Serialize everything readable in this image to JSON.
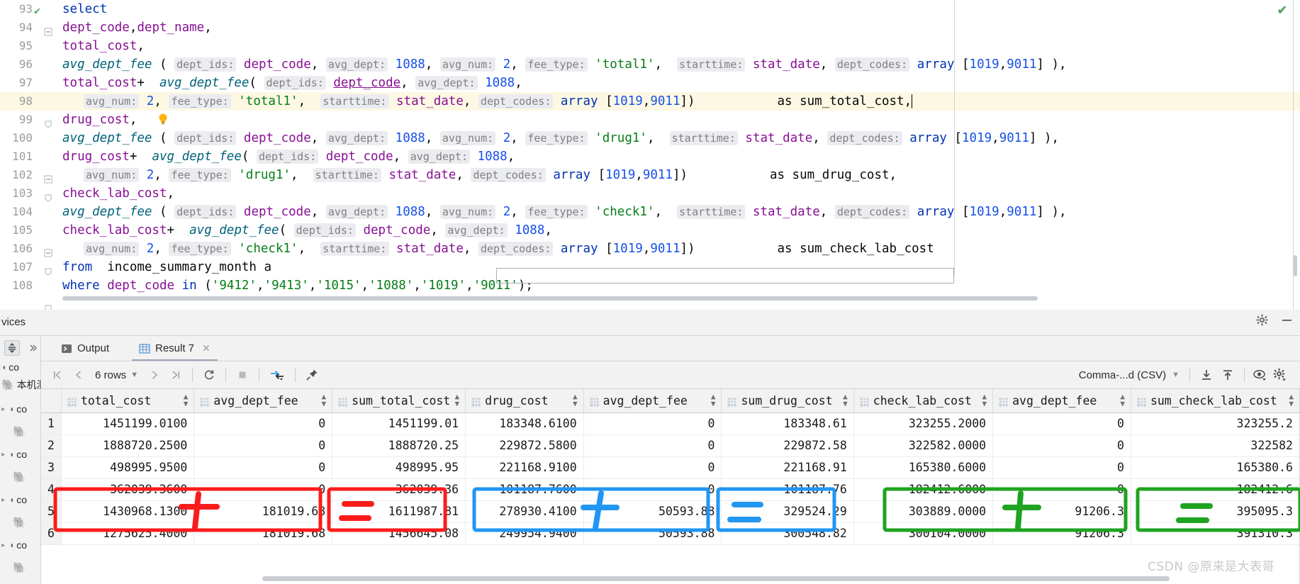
{
  "editor": {
    "first_line_status_icon": "checkmark-icon",
    "lines": [
      {
        "n": "93",
        "code": "select"
      },
      {
        "n": "94",
        "code": "dept_code,dept_name,"
      },
      {
        "n": "95",
        "code": "total_cost,"
      },
      {
        "n": "96",
        "code": "avg_dept_fee ( dept_ids: dept_code, avg_dept: 1088, avg_num: 2, fee_type: 'total1', starttime: stat_date, dept_codes: array [1019,9011] ),"
      },
      {
        "n": "97",
        "code": "total_cost+  avg_dept_fee( dept_ids: dept_code, avg_dept: 1088,"
      },
      {
        "n": "98",
        "code": "   avg_num: 2, fee_type: 'total1', starttime: stat_date, dept_codes: array [1019,9011])           as sum_total_cost,"
      },
      {
        "n": "99",
        "code": "drug_cost,"
      },
      {
        "n": "100",
        "code": "avg_dept_fee ( dept_ids: dept_code, avg_dept: 1088, avg_num: 2, fee_type: 'drug1', starttime: stat_date, dept_codes: array [1019,9011] ),"
      },
      {
        "n": "101",
        "code": "drug_cost+  avg_dept_fee( dept_ids: dept_code, avg_dept: 1088,"
      },
      {
        "n": "102",
        "code": "   avg_num: 2, fee_type: 'drug1', starttime: stat_date, dept_codes: array [1019,9011])           as sum_drug_cost,"
      },
      {
        "n": "103",
        "code": "check_lab_cost,"
      },
      {
        "n": "104",
        "code": "avg_dept_fee ( dept_ids: dept_code, avg_dept: 1088, avg_num: 2, fee_type: 'check1', starttime: stat_date, dept_codes: array [1019,9011] ),"
      },
      {
        "n": "105",
        "code": "check_lab_cost+  avg_dept_fee( dept_ids: dept_code, avg_dept: 1088,"
      },
      {
        "n": "106",
        "code": "   avg_num: 2, fee_type: 'check1', starttime: stat_date, dept_codes: array [1019,9011])           as sum_check_lab_cost"
      },
      {
        "n": "107",
        "code": "from  income_summary_month a"
      },
      {
        "n": "108",
        "code": "where dept_code in ('9412','9413','1015','1088','1019','9011');"
      }
    ]
  },
  "panel": {
    "title": "vices",
    "gear_icon": "gear-icon",
    "minimize_icon": "minimize-icon"
  },
  "sidebar": {
    "expand_all_icon": "expand-all-icon",
    "more_icon": "chevron-double-right-icon",
    "items": [
      {
        "label": "co",
        "icon": "plug-icon"
      },
      {
        "label": "本机测",
        "icon": "elephant-icon"
      },
      {
        "label": "co",
        "icon": "plug-icon"
      },
      {
        "label": "co",
        "icon": "plug-icon"
      },
      {
        "label": "co",
        "icon": "plug-icon"
      },
      {
        "label": "co",
        "icon": "plug-icon"
      },
      {
        "label": "co",
        "icon": "plug-icon"
      }
    ]
  },
  "tabs": [
    {
      "label": "Output",
      "icon": "console-icon",
      "selected": false,
      "closable": false
    },
    {
      "label": "Result 7",
      "icon": "table-icon",
      "selected": true,
      "closable": true
    }
  ],
  "result_toolbar": {
    "first_page_icon": "first-page-icon",
    "prev_page_icon": "prev-page-icon",
    "rows_label": "6 rows",
    "rows_dropdown_icon": "chevron-down-icon",
    "next_page_icon": "next-page-icon",
    "last_page_icon": "last-page-icon",
    "reload_icon": "refresh-icon",
    "stop_icon": "stop-icon",
    "transpose_icon": "transpose-icon",
    "pin_icon": "pin-icon",
    "format_label": "Comma-...d (CSV)",
    "format_dropdown_icon": "chevron-down-icon",
    "download_icon": "download-icon",
    "upload_icon": "upload-icon",
    "view_icon": "eye-icon",
    "settings_icon": "gear-icon"
  },
  "grid": {
    "columns": [
      {
        "name": "total_cost"
      },
      {
        "name": "avg_dept_fee"
      },
      {
        "name": "sum_total_cost"
      },
      {
        "name": "drug_cost"
      },
      {
        "name": "avg_dept_fee"
      },
      {
        "name": "sum_drug_cost"
      },
      {
        "name": "check_lab_cost"
      },
      {
        "name": "avg_dept_fee"
      },
      {
        "name": "sum_check_lab_cost"
      }
    ],
    "rows": [
      {
        "n": "1",
        "cells": [
          "1451199.0100",
          "0",
          "1451199.01",
          "183348.6100",
          "0",
          "183348.61",
          "323255.2000",
          "0",
          "323255.2"
        ]
      },
      {
        "n": "2",
        "cells": [
          "1888720.2500",
          "0",
          "1888720.25",
          "229872.5800",
          "0",
          "229872.58",
          "322582.0000",
          "0",
          "322582"
        ]
      },
      {
        "n": "3",
        "cells": [
          "498995.9500",
          "0",
          "498995.95",
          "221168.9100",
          "0",
          "221168.91",
          "165380.6000",
          "0",
          "165380.6"
        ]
      },
      {
        "n": "4",
        "cells": [
          "362039.3600",
          "0",
          "362039.36",
          "101187.7600",
          "0",
          "101187.76",
          "182412.6000",
          "0",
          "182412.6"
        ]
      },
      {
        "n": "5",
        "cells": [
          "1430968.1300",
          "181019.68",
          "1611987.81",
          "278930.4100",
          "50593.88",
          "329524.29",
          "303889.0000",
          "91206.3",
          "395095.3"
        ]
      },
      {
        "n": "6",
        "cells": [
          "1275625.4000",
          "181019.68",
          "1456645.08",
          "249954.9400",
          "50593.88",
          "300548.82",
          "300104.0000",
          "91206.3",
          "391310.3"
        ]
      }
    ]
  },
  "annotations": [
    {
      "name": "total-cost-plus-group",
      "color": "#ff1a1a",
      "sign": "plus"
    },
    {
      "name": "sum-total-cost-equals-group",
      "color": "#ff1a1a",
      "sign": "equals"
    },
    {
      "name": "drug-cost-plus-group",
      "color": "#1e90ff",
      "sign": "plus"
    },
    {
      "name": "sum-drug-cost-equals-group",
      "color": "#1e90ff",
      "sign": "equals"
    },
    {
      "name": "check-lab-cost-plus-group",
      "color": "#22aa22",
      "sign": "plus"
    },
    {
      "name": "sum-check-lab-cost-equals-group",
      "color": "#22aa22",
      "sign": "equals"
    }
  ],
  "watermark": "CSDN @原来是大表哥"
}
